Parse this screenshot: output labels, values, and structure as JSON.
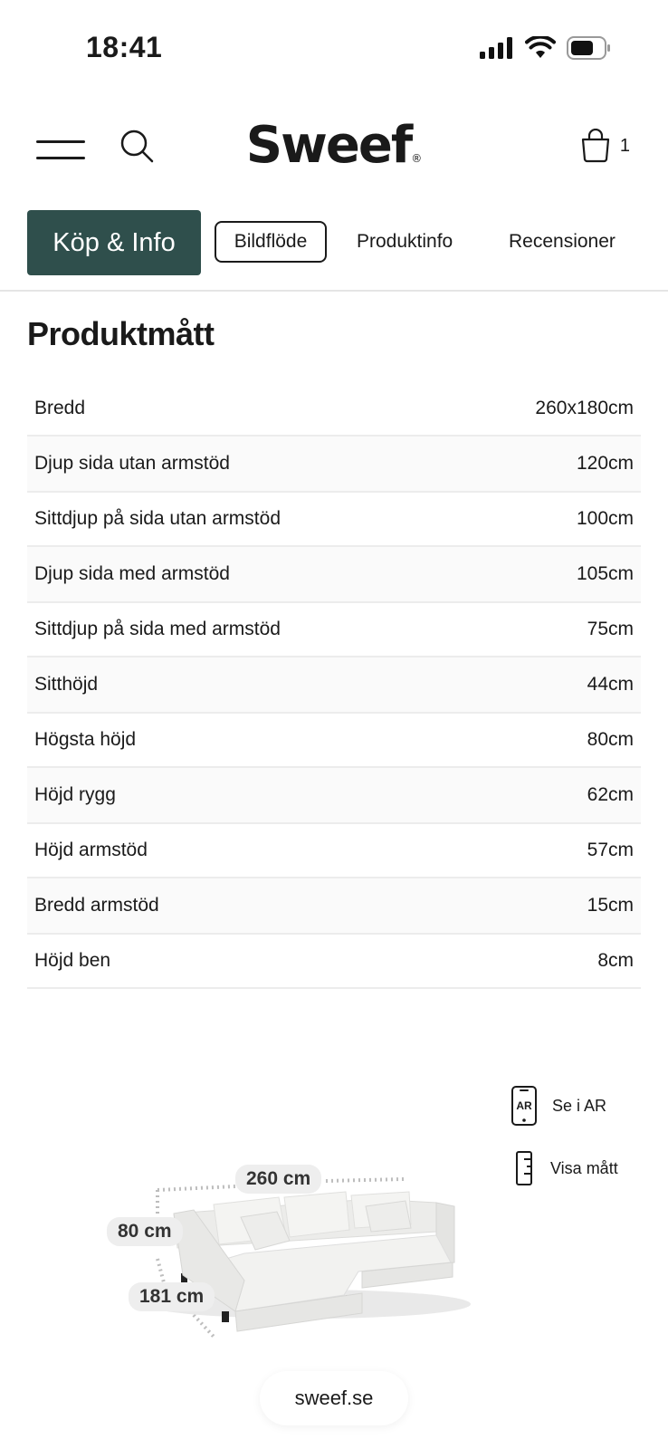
{
  "status_bar": {
    "time": "18:41"
  },
  "header": {
    "logo": "Sweef",
    "logo_mark": "®",
    "cart_count": "1"
  },
  "tabs": {
    "primary": "Köp & Info",
    "items": [
      "Bildflöde",
      "Produktinfo",
      "Recensioner"
    ]
  },
  "section": {
    "title": "Produktmått"
  },
  "dimensions": [
    {
      "label": "Bredd",
      "value": "260x180cm"
    },
    {
      "label": "Djup sida utan armstöd",
      "value": "120cm"
    },
    {
      "label": "Sittdjup på sida utan armstöd",
      "value": "100cm"
    },
    {
      "label": "Djup sida med armstöd",
      "value": "105cm"
    },
    {
      "label": "Sittdjup på sida med armstöd",
      "value": "75cm"
    },
    {
      "label": "Sitthöjd",
      "value": "44cm"
    },
    {
      "label": "Högsta höjd",
      "value": "80cm"
    },
    {
      "label": "Höjd rygg",
      "value": "62cm"
    },
    {
      "label": "Höjd armstöd",
      "value": "57cm"
    },
    {
      "label": "Bredd armstöd",
      "value": "15cm"
    },
    {
      "label": "Höjd ben",
      "value": "8cm"
    }
  ],
  "viewer": {
    "ar_icon_text": "AR",
    "ar_label": "Se i AR",
    "measure_label": "Visa mått",
    "width_tag": "260 cm",
    "height_tag": "80 cm",
    "depth_tag": "181 cm",
    "url": "sweef.se"
  },
  "colors": {
    "accent": "#2f4f4c",
    "text": "#1a1a1a",
    "divider": "#ececec"
  },
  "icons": [
    "cellular-signal-icon",
    "wifi-icon",
    "battery-icon",
    "menu-icon",
    "search-icon",
    "shopping-bag-icon",
    "ar-phone-icon",
    "ruler-icon"
  ]
}
